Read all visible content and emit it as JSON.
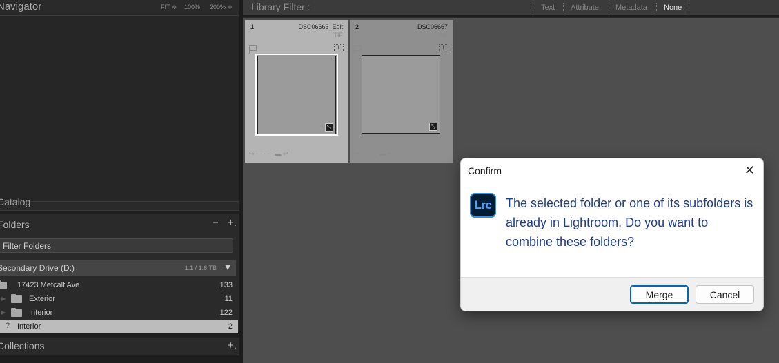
{
  "navigator": {
    "title": "Navigator",
    "fit_label": "FIT ≑",
    "zoom_100": "100%",
    "zoom_200": "200% ≑"
  },
  "catalog": {
    "title": "Catalog"
  },
  "folders": {
    "title": "Folders",
    "minus": "−",
    "plus": "+.",
    "filter_placeholder": "Filter Folders",
    "drive": {
      "label": "Secondary Drive (D:)",
      "size": "1.1 / 1.6 TB",
      "arrow": "▼"
    },
    "items": [
      {
        "name": "17423 Metcalf Ave",
        "count": "133"
      },
      {
        "name": "Exterior",
        "count": "11"
      },
      {
        "name": "Interior",
        "count": "122"
      },
      {
        "name": "Interior",
        "count": "2"
      }
    ]
  },
  "collections": {
    "title": "Collections",
    "plus": "+."
  },
  "filter_bar": {
    "title": "Library Filter :",
    "options": [
      "Text",
      "Attribute",
      "Metadata",
      "None"
    ]
  },
  "grid": {
    "cells": [
      {
        "index": "1",
        "filename": "DSC06663_Edit",
        "type": "TIF",
        "warn": "!",
        "badge": "⤡",
        "bottom": "↪ · · · · ·  ▬ ↩"
      },
      {
        "index": "2",
        "filename": "DSC06667",
        "type": "TIF",
        "warn": "!",
        "badge": "⤡",
        "bottom": "↪ · · · · ·  ▬ ↩"
      }
    ]
  },
  "dialog": {
    "title": "Confirm",
    "close": "✕",
    "icon_text": "Lrc",
    "message": "The selected folder or one of its subfolders is already in Lightroom. Do you want to combine these folders?",
    "merge_label": "Merge",
    "cancel_label": "Cancel"
  },
  "colors": {
    "dialog_text": "#1f3d8a",
    "default_button_border": "#0067c0",
    "lrc_icon_bg": "#001d34",
    "lrc_icon_fg": "#4aa3ff"
  }
}
